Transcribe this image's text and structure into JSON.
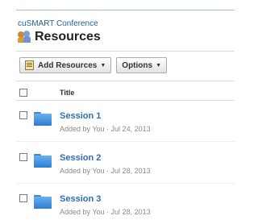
{
  "context": "cuSMART Conference",
  "page_title": "Resources",
  "toolbar": {
    "add_label": "Add Resources",
    "options_label": "Options"
  },
  "table": {
    "header_title": "Title",
    "rows": [
      {
        "name": "Session 1",
        "meta": "Added by You · Jul 24, 2013"
      },
      {
        "name": "Session 2",
        "meta": "Added by You · Jul 28, 2013"
      },
      {
        "name": "Session 3",
        "meta": "Added by You · Jul 28, 2013"
      }
    ]
  },
  "icons": {
    "title": "people-icon",
    "add": "resources-list-icon",
    "dropdown": "caret-down-icon",
    "row": "folder-icon"
  },
  "colors": {
    "link": "#2e6db5",
    "muted": "#8a8a8a",
    "accent_rule": "#9cce9c"
  }
}
